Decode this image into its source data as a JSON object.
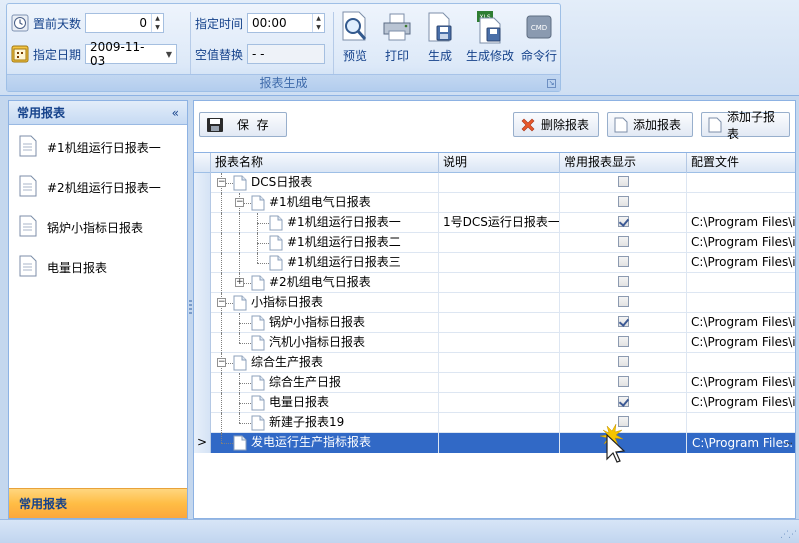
{
  "ribbon": {
    "group_caption": "报表生成",
    "fields": {
      "preset_days_label": "置前天数",
      "preset_days_value": "0",
      "date_label": "指定日期",
      "date_value": "2009-11-03",
      "time_label": "指定时间",
      "time_value": "00:00",
      "null_replace_label": "空值替换",
      "null_replace_value": "- -"
    },
    "buttons": {
      "preview": "预览",
      "print": "打印",
      "generate": "生成",
      "generate_modify": "生成修改",
      "command_line": "命令行"
    },
    "xls_badge": "XLS",
    "cmd_badge": "CMD"
  },
  "left_panel": {
    "title": "常用报表",
    "collapse_glyph": "«",
    "items": [
      {
        "label": "#1机组运行日报表一"
      },
      {
        "label": "#2机组运行日报表一"
      },
      {
        "label": "锅炉小指标日报表"
      },
      {
        "label": "电量日报表"
      }
    ],
    "footer": "常用报表"
  },
  "toolbar": {
    "save": "保  存",
    "delete": "删除报表",
    "add": "添加报表",
    "add_child": "添加子报表"
  },
  "grid": {
    "columns": [
      "报表名称",
      "说明",
      "常用报表显示",
      "配置文件"
    ],
    "rows": [
      {
        "name": "DCS日报表",
        "desc": "",
        "checked": false,
        "file": ""
      },
      {
        "name": "#1机组电气日报表",
        "desc": "",
        "checked": false,
        "file": ""
      },
      {
        "name": "#1机组运行日报表一",
        "desc": "1号DCS运行日报表一",
        "checked": true,
        "file": "C:\\Program Files\\iC..."
      },
      {
        "name": "#1机组运行日报表二",
        "desc": "",
        "checked": false,
        "file": "C:\\Program Files\\iC..."
      },
      {
        "name": "#1机组运行日报表三",
        "desc": "",
        "checked": false,
        "file": "C:\\Program Files\\iC..."
      },
      {
        "name": "#2机组电气日报表",
        "desc": "",
        "checked": false,
        "file": ""
      },
      {
        "name": "小指标日报表",
        "desc": "",
        "checked": false,
        "file": ""
      },
      {
        "name": "锅炉小指标日报表",
        "desc": "",
        "checked": true,
        "file": "C:\\Program Files\\iC..."
      },
      {
        "name": "汽机小指标日报表",
        "desc": "",
        "checked": false,
        "file": "C:\\Program Files\\iC..."
      },
      {
        "name": "综合生产报表",
        "desc": "",
        "checked": false,
        "file": ""
      },
      {
        "name": "综合生产日报",
        "desc": "",
        "checked": false,
        "file": "C:\\Program Files\\iC..."
      },
      {
        "name": "电量日报表",
        "desc": "",
        "checked": true,
        "file": "C:\\Program Files\\iC..."
      },
      {
        "name": "新建子报表19",
        "desc": "",
        "checked": false,
        "file": ""
      },
      {
        "name": "发电运行生产指标报表",
        "desc": "",
        "checked": false,
        "file": "C:\\Program Files..."
      }
    ],
    "selected_indicator": ">",
    "ellipsis": "···"
  },
  "colors": {
    "accent": "#3169c6",
    "orange_tab": "#ffbd45",
    "ribbon_bg": "#dde9f8"
  }
}
